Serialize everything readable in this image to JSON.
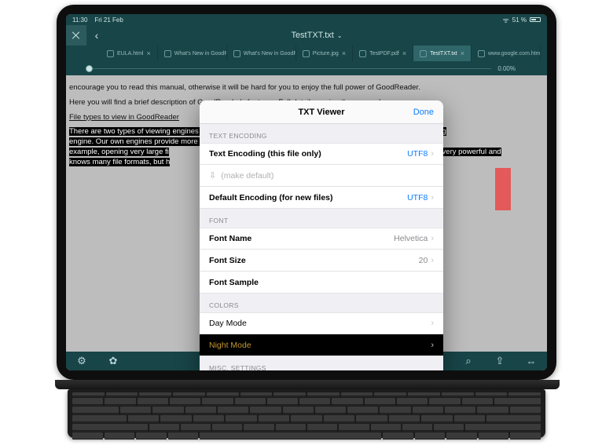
{
  "status": {
    "time": "11:30",
    "date": "Fri 21 Feb",
    "battery_pct": "51 %"
  },
  "topnav": {
    "doc_title": "TestTXT.txt"
  },
  "tabs": [
    {
      "label": "EULA.html"
    },
    {
      "label": "What's New in GoodRea…"
    },
    {
      "label": "What's New in GoodRea…"
    },
    {
      "label": "Picture.jpg"
    },
    {
      "label": "TestPDF.pdf"
    },
    {
      "label": "TestTXT.txt",
      "active": true
    },
    {
      "label": "www.google.com.html"
    }
  ],
  "slider": {
    "percent": "0.00%"
  },
  "document": {
    "line1": "encourage you to read this manual, otherwise it will be hard for you to enjoy the full power of GoodReader.",
    "line2": "Here you will find a brief description of GoodReader's features. Full details are in other manuals.",
    "heading": "File types to view in GoodReader",
    "sel1": "There are two types of viewing engines in GoodReader – our own engines and a built-in device's standard viewing",
    "sel2": "engine. Our own engines provide more functionality and convenience for certain file types. The built-in engine (for",
    "sel3a": "example, opening very large fi",
    "sel3b": ", is very powerful and",
    "sel4a": "knows many file formats, but h"
  },
  "popover": {
    "title": "TXT Viewer",
    "done": "Done",
    "groups": {
      "text_encoding": "TEXT ENCODING",
      "font": "FONT",
      "colors": "COLORS",
      "misc": "MISC. SETTINGS"
    },
    "rows": {
      "encoding_this": {
        "label": "Text Encoding (this file only)",
        "value": "UTF8"
      },
      "make_default": {
        "label": "(make default)"
      },
      "encoding_default": {
        "label": "Default Encoding (for new files)",
        "value": "UTF8"
      },
      "font_name": {
        "label": "Font Name",
        "value": "Helvetica"
      },
      "font_size": {
        "label": "Font Size",
        "value": "20"
      },
      "font_sample": {
        "label": "Font Sample"
      },
      "day_mode": {
        "label": "Day Mode"
      },
      "night_mode": {
        "label": "Night Mode"
      }
    }
  }
}
